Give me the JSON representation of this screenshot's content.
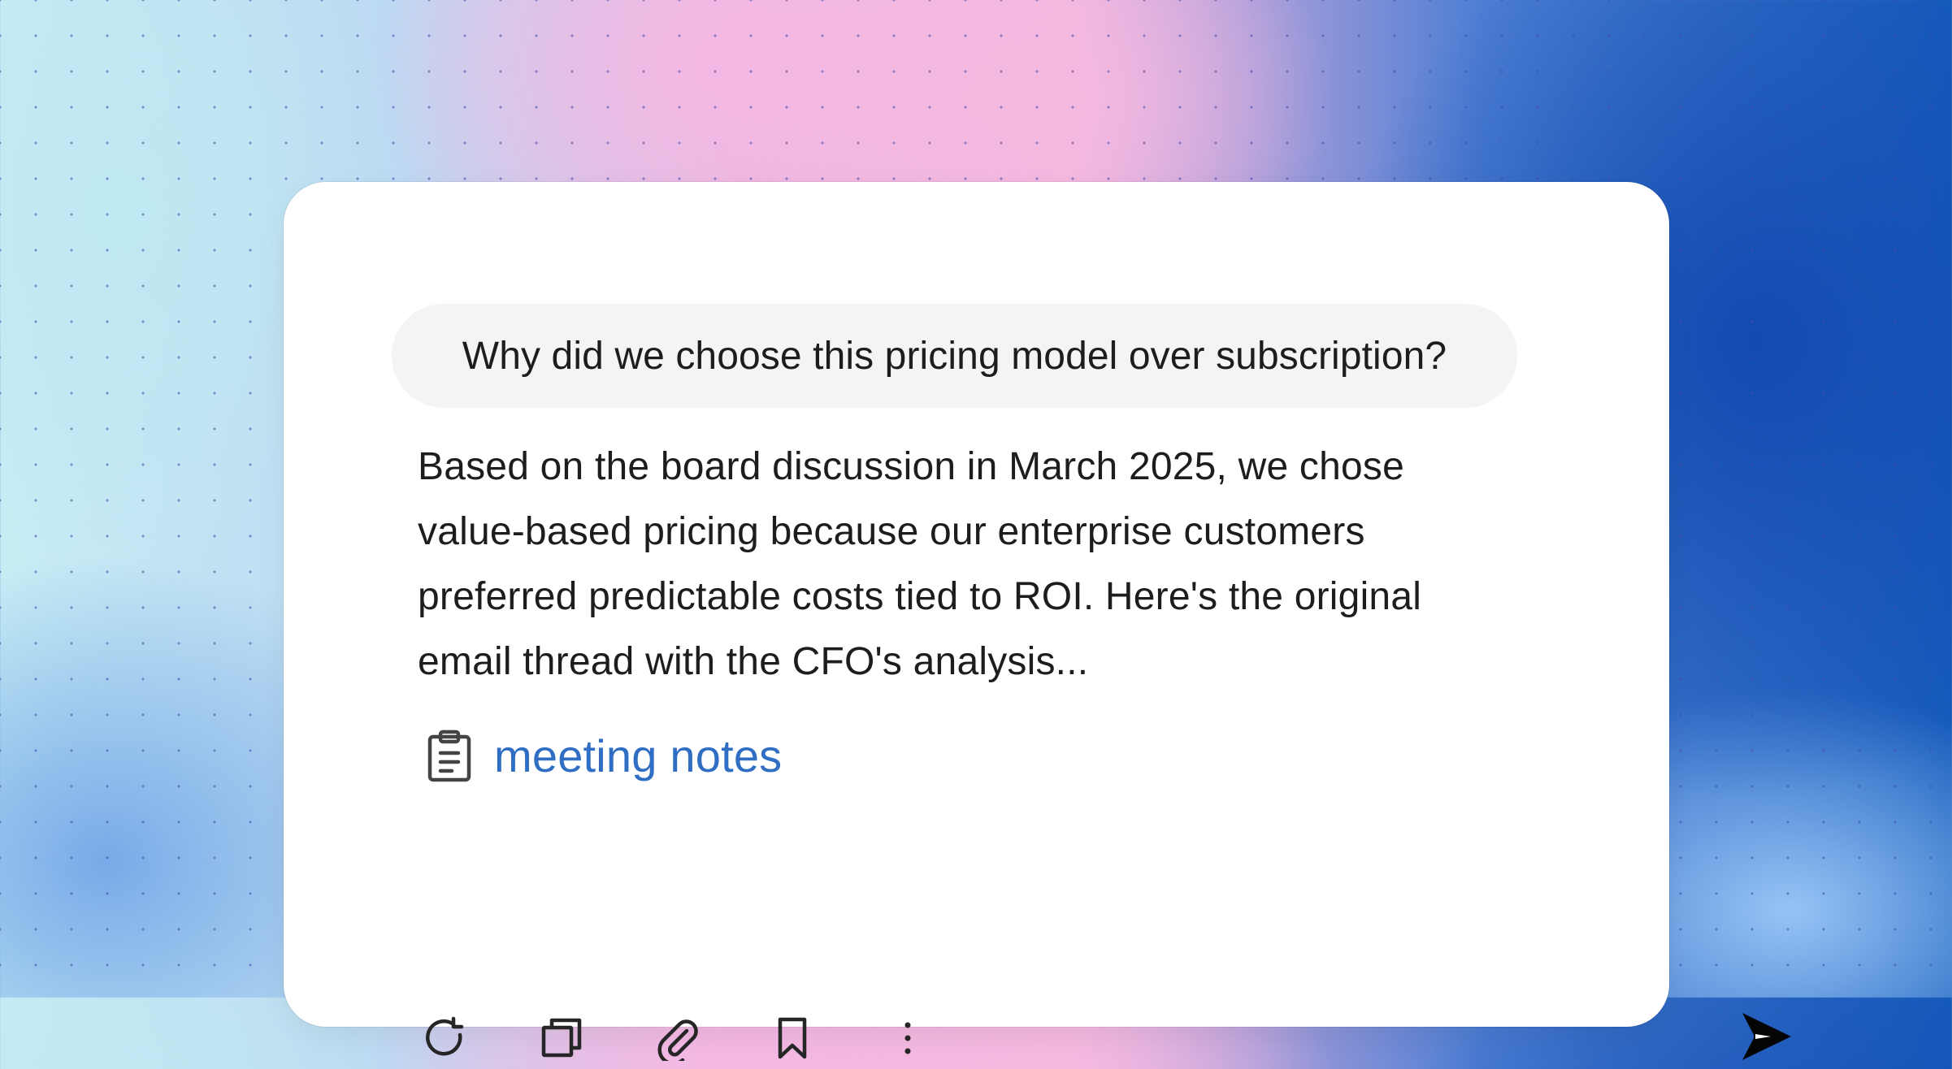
{
  "conversation": {
    "question": "Why did we choose this pricing model over subscription?",
    "answer_lines": [
      "Based on the board discussion in March 2025, we chose",
      "value-based pricing because our enterprise customers",
      "preferred predictable costs tied to ROI. Here's the original",
      "email thread with the CFO's analysis..."
    ],
    "source": {
      "icon": "clipboard-icon",
      "label": "meeting notes",
      "color": "#2f6ec3"
    }
  },
  "toolbar": {
    "actions": [
      {
        "icon": "refresh-icon"
      },
      {
        "icon": "copy-icon"
      },
      {
        "icon": "paperclip-icon"
      },
      {
        "icon": "bookmark-icon"
      },
      {
        "icon": "more-vertical-icon"
      }
    ],
    "send_icon": "send-icon"
  },
  "colors": {
    "card_background": "#ffffff",
    "question_background": "#f4f4f4",
    "text": "#1d1d1f",
    "link": "#2f6ec3",
    "icon": "#2a2a2a"
  }
}
